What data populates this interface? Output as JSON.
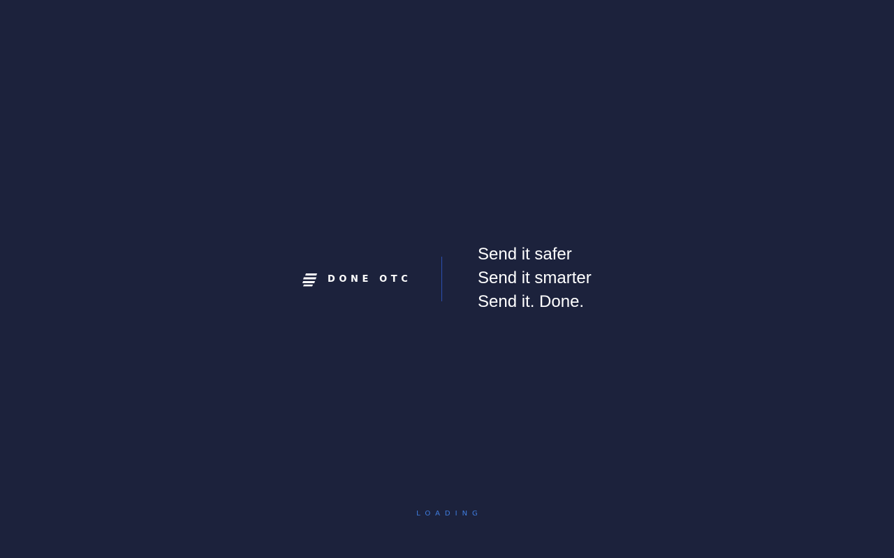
{
  "brand": {
    "name": "DONE OTC",
    "icon": "done-otc-logo-icon"
  },
  "taglines": [
    "Send it safer",
    "Send it smarter",
    "Send it. Done."
  ],
  "status": {
    "loading_text": "LOADING"
  },
  "colors": {
    "background": "#1c223c",
    "text": "#ffffff",
    "accent": "#3f7de0",
    "divider": "#2b4fb0"
  }
}
